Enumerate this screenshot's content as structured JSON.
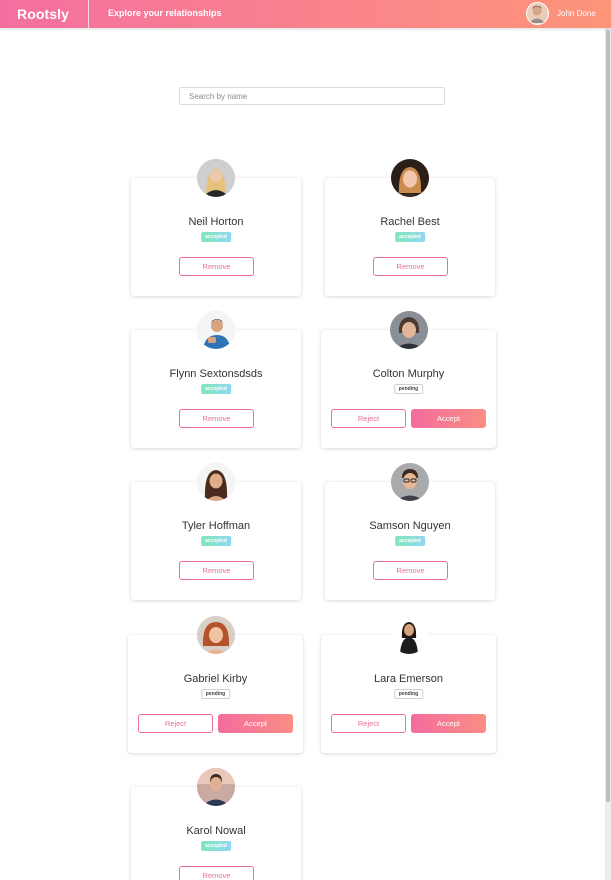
{
  "header": {
    "logo": "Rootsly",
    "tagline": "Explore your relationships",
    "user_name": "John Done"
  },
  "search": {
    "placeholder": "Search by name",
    "value": ""
  },
  "cards": [
    {
      "name": "Neil Horton",
      "status": "accepted",
      "actions": [
        "Remove"
      ]
    },
    {
      "name": "Rachel Best",
      "status": "accepted",
      "actions": [
        "Remove"
      ]
    },
    {
      "name": "Flynn Sextonsdsds",
      "status": "accepted",
      "actions": [
        "Remove"
      ]
    },
    {
      "name": "Colton Murphy",
      "status": "pending",
      "actions": [
        "Reject",
        "Accept"
      ]
    },
    {
      "name": "Tyler Hoffman",
      "status": "accepted",
      "actions": [
        "Remove"
      ]
    },
    {
      "name": "Samson Nguyen",
      "status": "accepted",
      "actions": [
        "Remove"
      ]
    },
    {
      "name": "Gabriel Kirby",
      "status": "pending",
      "actions": [
        "Reject",
        "Accept"
      ]
    },
    {
      "name": "Lara Emerson",
      "status": "pending",
      "actions": [
        "Reject",
        "Accept"
      ]
    },
    {
      "name": "Karol Nowal",
      "status": "accepted",
      "actions": [
        "Remove"
      ]
    }
  ],
  "colors": {
    "brand_start": "#f46fa0",
    "brand_end": "#fd9478",
    "button_accent": "#ea6f98",
    "accepted_badge": "#83e6b8"
  }
}
